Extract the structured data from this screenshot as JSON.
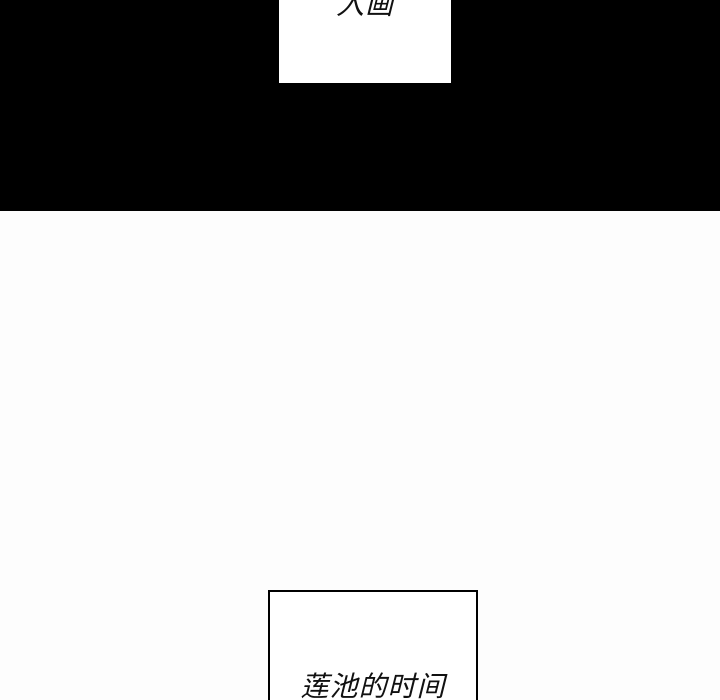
{
  "panels": {
    "top_caption": "入画",
    "bottom_caption": "莲池的时间"
  },
  "colors": {
    "panel_black": "#000000",
    "page_background": "#fdfdfd",
    "caption_background": "#ffffff"
  }
}
